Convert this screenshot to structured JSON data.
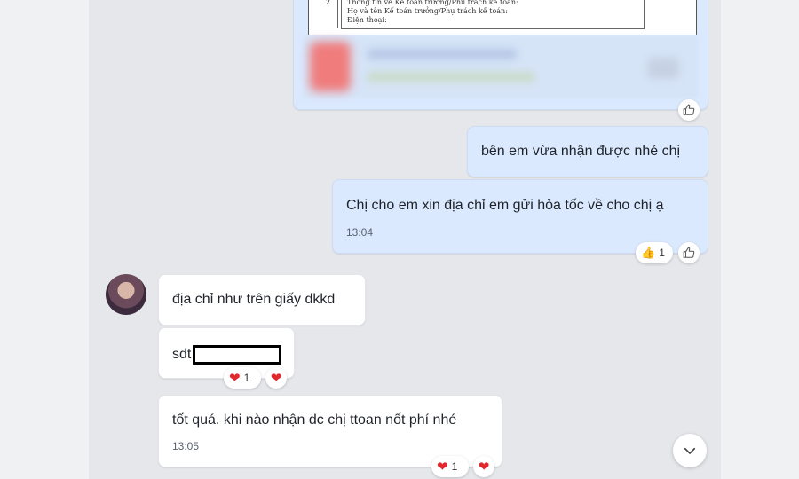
{
  "messages": {
    "image_message": {
      "doc_number": "2",
      "doc_lines": [
        "Thông tin về Kế toán trưởng/Phụ trách kế toán:",
        "Họ và tên Kế toán trưởng/Phụ trách kế toán:",
        "Điện thoại:"
      ]
    },
    "m1": {
      "text": "bên em vừa nhận được nhé chị"
    },
    "m2": {
      "text": "Chị cho em xin địa chỉ em gửi hỏa tốc về cho chị ạ",
      "time": "13:04",
      "reaction": {
        "emoji": "👍",
        "count": "1"
      }
    },
    "m3": {
      "text": "địa chỉ như trên giấy dkkd"
    },
    "m4": {
      "prefix": "sdt",
      "reaction": {
        "emoji": "❤",
        "count": "1"
      }
    },
    "m5": {
      "text": "tốt quá. khi nào nhận dc chị ttoan nốt phí nhé",
      "time": "13:05",
      "reaction": {
        "emoji": "❤",
        "count": "1"
      }
    }
  },
  "icons": {
    "like": "thumbs-up-outline-icon",
    "heart": "heart-icon",
    "scroll": "chevron-down-icon"
  },
  "colors": {
    "mine_bubble": "#dbe9ff",
    "theirs_bubble": "#ffffff",
    "heart": "#e0282e",
    "background": "#e5e7eb"
  }
}
